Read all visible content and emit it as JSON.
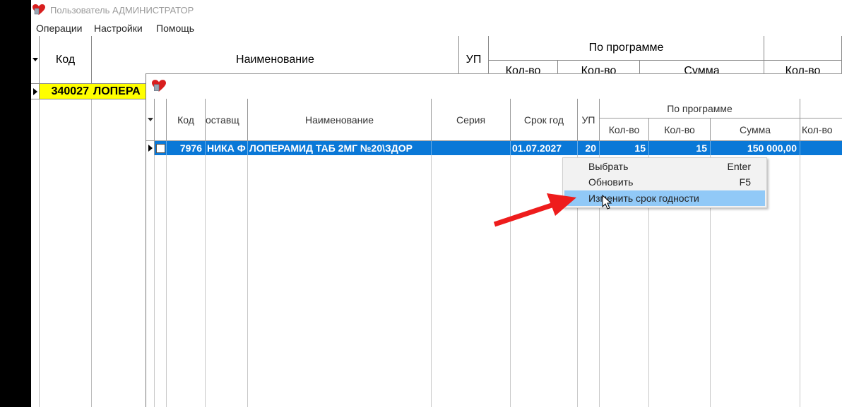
{
  "window": {
    "title": "Пользователь АДМИНИСТРАТОР"
  },
  "menu": [
    "Операции",
    "Настройки",
    "Помощь"
  ],
  "main_grid": {
    "headers": {
      "code": "Код",
      "name": "Наименование",
      "up": "УП",
      "program_group": "По программе",
      "qty1": "Кол-во",
      "qty2": "Кол-во",
      "sum": "Сумма",
      "qty3": "Кол-во"
    },
    "row": {
      "code": "340027",
      "name": "ЛОПЕРА"
    }
  },
  "dialog": {
    "headers": {
      "code": "Код",
      "supplier": "оставщ",
      "name": "Наименование",
      "series": "Серия",
      "expiry": "Срок год",
      "up": "УП",
      "program_group": "По программе",
      "qty1": "Кол-во",
      "qty2": "Кол-во",
      "sum": "Сумма",
      "qty3": "Кол-во"
    },
    "row": {
      "code": "7976",
      "supplier": "НИКА Ф",
      "name": "ЛОПЕРАМИД ТАБ 2МГ №20\\ЗДОР",
      "series": "",
      "expiry": "01.07.2027",
      "up": "20",
      "qty1": "15",
      "qty2": "15",
      "sum": "150 000,00"
    }
  },
  "context_menu": [
    {
      "label": "Выбрать",
      "shortcut": "Enter"
    },
    {
      "label": "Обновить",
      "shortcut": "F5"
    },
    {
      "label": "Изменить срок годности",
      "shortcut": ""
    }
  ],
  "colors": {
    "highlight_row": "#ffff00",
    "selected_row": "#0a78d7",
    "menu_hover": "#91c9f7",
    "arrow": "#ee1c1c"
  }
}
